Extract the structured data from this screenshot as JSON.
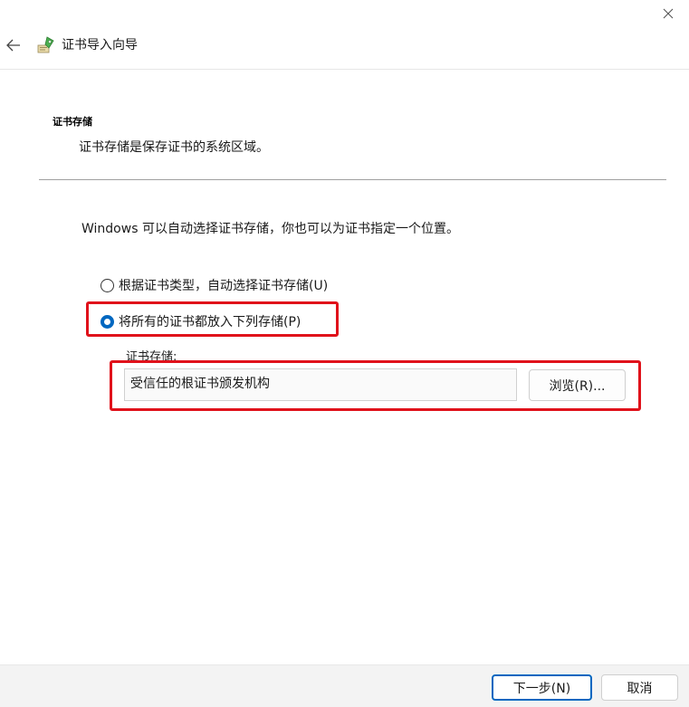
{
  "window": {
    "close_icon": "close-icon"
  },
  "header": {
    "back_icon": "arrow-left-icon",
    "wizard_icon": "certificate-icon",
    "title": "证书导入向导"
  },
  "section": {
    "title": "证书存储",
    "description": "证书存储是保存证书的系统区域。"
  },
  "intro": "Windows 可以自动选择证书存储，你也可以为证书指定一个位置。",
  "options": [
    {
      "label": "根据证书类型，自动选择证书存储(U)",
      "checked": false
    },
    {
      "label": "将所有的证书都放入下列存储(P)",
      "checked": true
    }
  ],
  "store": {
    "label": "证书存储:",
    "value": "受信任的根证书颁发机构",
    "browse_label": "浏览(R)..."
  },
  "footer": {
    "next_label": "下一步(N)",
    "cancel_label": "取消"
  },
  "colors": {
    "accent": "#0067c0",
    "highlight": "#e0121b"
  }
}
